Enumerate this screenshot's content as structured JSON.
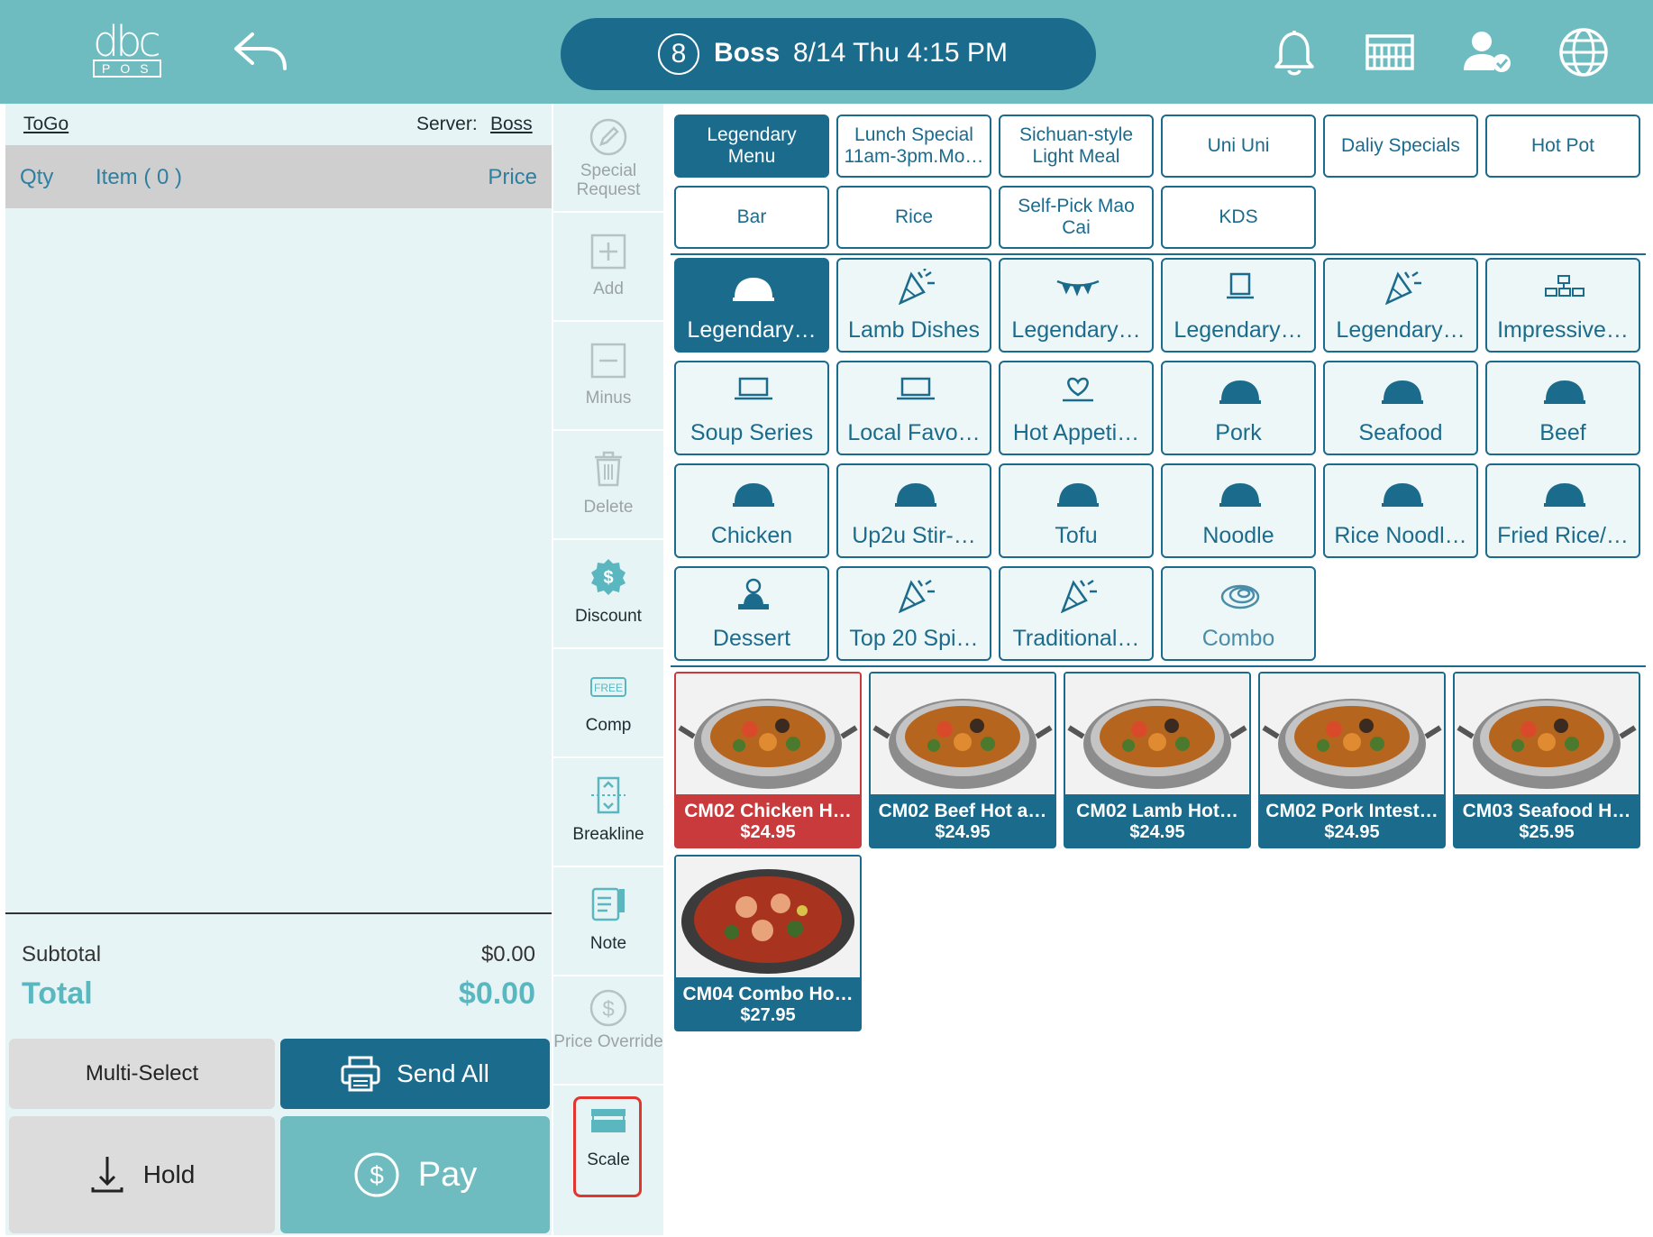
{
  "header": {
    "logo_top": "dbc",
    "logo_bottom": "POS",
    "seat_number": "8",
    "user": "Boss",
    "datetime": "8/14 Thu 4:15 PM"
  },
  "order": {
    "order_type": "ToGo",
    "server_label": "Server:",
    "server_name": "Boss",
    "col_qty": "Qty",
    "col_item": "Item ( 0 )",
    "col_price": "Price",
    "subtotal_label": "Subtotal",
    "subtotal_value": "$0.00",
    "total_label": "Total",
    "total_value": "$0.00"
  },
  "actions": {
    "multi_select": "Multi-Select",
    "send_all": "Send All",
    "hold": "Hold",
    "pay": "Pay"
  },
  "functions": [
    {
      "label": "Special Request",
      "icon": "pencil-icon",
      "enabled": false
    },
    {
      "label": "Add",
      "icon": "plus-box-icon",
      "enabled": false
    },
    {
      "label": "Minus",
      "icon": "minus-box-icon",
      "enabled": false
    },
    {
      "label": "Delete",
      "icon": "trash-icon",
      "enabled": false
    },
    {
      "label": "Discount",
      "icon": "discount-badge-icon",
      "enabled": true
    },
    {
      "label": "Comp",
      "icon": "free-tag-icon",
      "enabled": true
    },
    {
      "label": "Breakline",
      "icon": "breakline-icon",
      "enabled": true
    },
    {
      "label": "Note",
      "icon": "note-icon",
      "enabled": true
    },
    {
      "label": "Price Override",
      "icon": "dollar-circle-icon",
      "enabled": false
    },
    {
      "label": "Scale",
      "icon": "scale-icon",
      "enabled": true
    }
  ],
  "menus": [
    {
      "label": "Legendary Menu",
      "active": true
    },
    {
      "label": "Lunch Special 11am-3pm.Mo…",
      "active": false
    },
    {
      "label": "Sichuan-style Light Meal",
      "active": false
    },
    {
      "label": "Uni Uni",
      "active": false
    },
    {
      "label": "Daliy Specials",
      "active": false
    },
    {
      "label": "Hot Pot",
      "active": false
    },
    {
      "label": "Bar",
      "active": false
    },
    {
      "label": "Rice",
      "active": false
    },
    {
      "label": "Self-Pick Mao Cai",
      "active": false
    },
    {
      "label": "KDS",
      "active": false
    }
  ],
  "categories": [
    {
      "label": "Legendary…",
      "icon": "cloche-icon",
      "active": true
    },
    {
      "label": "Lamb Dishes",
      "icon": "party-popper-icon",
      "active": false
    },
    {
      "label": "Legendary…",
      "icon": "bunting-icon",
      "active": false
    },
    {
      "label": "Legendary…",
      "icon": "frame-icon",
      "active": false
    },
    {
      "label": "Legendary…",
      "icon": "party-popper-icon",
      "active": false
    },
    {
      "label": "Impressive…",
      "icon": "blocks-icon",
      "active": false
    },
    {
      "label": "Soup Series",
      "icon": "laptop-icon",
      "active": false
    },
    {
      "label": "Local Favo…",
      "icon": "laptop-icon",
      "active": false
    },
    {
      "label": "Hot Appeti…",
      "icon": "heart-icon",
      "active": false
    },
    {
      "label": "Pork",
      "icon": "cloche-icon",
      "active": false
    },
    {
      "label": "Seafood",
      "icon": "cloche-icon",
      "active": false
    },
    {
      "label": "Beef",
      "icon": "cloche-icon",
      "active": false
    },
    {
      "label": "Chicken",
      "icon": "cloche-icon",
      "active": false
    },
    {
      "label": "Up2u Stir-…",
      "icon": "cloche-icon",
      "active": false
    },
    {
      "label": "Tofu",
      "icon": "cloche-icon",
      "active": false
    },
    {
      "label": "Noodle",
      "icon": "cloche-icon",
      "active": false
    },
    {
      "label": "Rice Noodl…",
      "icon": "cloche-icon",
      "active": false
    },
    {
      "label": "Fried Rice/…",
      "icon": "cloche-icon",
      "active": false
    },
    {
      "label": "Dessert",
      "icon": "chef-icon",
      "active": false
    },
    {
      "label": "Top 20 Spi…",
      "icon": "party-popper-icon",
      "active": false
    },
    {
      "label": "Traditional…",
      "icon": "party-popper-icon",
      "active": false
    },
    {
      "label": "Combo",
      "icon": "coil-icon",
      "active": false
    }
  ],
  "items": [
    {
      "name": "CM02 Chicken H…",
      "price": "$24.95",
      "selected": true
    },
    {
      "name": "CM02 Beef Hot a…",
      "price": "$24.95",
      "selected": false
    },
    {
      "name": "CM02 Lamb Hot…",
      "price": "$24.95",
      "selected": false
    },
    {
      "name": "CM02 Pork Intest…",
      "price": "$24.95",
      "selected": false
    },
    {
      "name": "CM03 Seafood H…",
      "price": "$25.95",
      "selected": false
    },
    {
      "name": "CM04 Combo Ho…",
      "price": "$27.95",
      "selected": false
    }
  ],
  "colors": {
    "header": "#6fbcc0",
    "primary": "#1b6b8d",
    "panel": "#e7f4f5",
    "selected_item": "#c83a3c",
    "highlight_outline": "#e0362f"
  }
}
